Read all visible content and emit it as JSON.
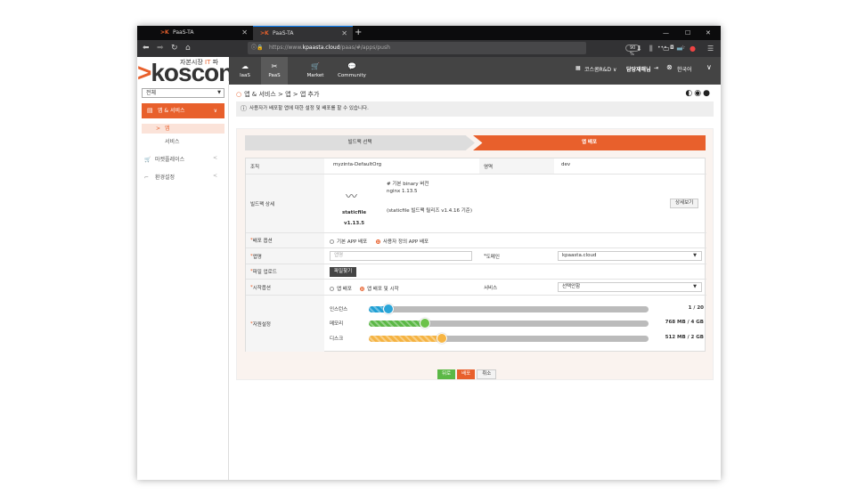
{
  "browser": {
    "tabs": [
      {
        "title": "PaaS-TA"
      },
      {
        "title": "PaaS-TA"
      }
    ],
    "new_tab": "+",
    "url_scheme": "https://www.",
    "url_host": "kpaasta.cloud",
    "url_path": "/paas/#/apps/push",
    "zoom": "90 %"
  },
  "brand": {
    "tagline_prefix": "자본시장 ",
    "tagline_it": "IT",
    "tagline_suffix": " 파",
    "logo_chevron": ">",
    "logo_text": "koscon"
  },
  "topnav": {
    "items": [
      {
        "label": "laaS",
        "icon": "cloud-icon"
      },
      {
        "label": "PaaS",
        "icon": "tools-icon"
      },
      {
        "label": "Market",
        "icon": "cart-icon"
      },
      {
        "label": "Community",
        "icon": "chat-icon"
      }
    ],
    "org": "코스콤R&D",
    "user": "담당재해님",
    "language": "한국어"
  },
  "sidebar": {
    "org_select": "전체",
    "menu_app": "앱 & 서비스",
    "sub_app": "앱",
    "sub_service": "서비스",
    "marketplace": "마켓플레이스",
    "env_settings": "환경설정"
  },
  "page": {
    "breadcrumb": "앱 & 서비스 > 앱 > 앱 추가",
    "info": "사용자가 배포할 앱에 대한 설정 및 배포를 할 수 있습니다."
  },
  "steps": {
    "step1": "빌드팩 선택",
    "step2": "앱 배포"
  },
  "form": {
    "org_label": "조직",
    "org_value": "myzinta-DefaultOrg",
    "space_label": "영역",
    "space_value": "dev",
    "buildpack_label": "빌드팩 상세",
    "buildpack_name": "staticfile",
    "buildpack_version": "v1.13.5",
    "buildpack_desc1": "# 기본 binary 버전",
    "buildpack_desc2": "nginx 1.13.5",
    "buildpack_desc3": "(staticfile 빌드팩 릴리즈 v1.4.16 기준)",
    "detail_button": "상세보기",
    "deploy_option_label": "배포 옵션",
    "deploy_opt1": "기본 APP 배포",
    "deploy_opt2": "사용자 정의 APP 배포",
    "appname_label": "앱명",
    "appname_placeholder": "앱명",
    "domain_label": "도메인",
    "domain_value": "kpaasta.cloud",
    "upload_label": "파일 업로드",
    "upload_button": "파일찾기",
    "start_option_label": "시작옵션",
    "start_opt1": "앱 배포",
    "start_opt2": "앱 배포 및 시작",
    "service_label": "서비스",
    "service_value": "선택안함",
    "resource_label": "자원설정",
    "resources": [
      {
        "label": "인스턴스",
        "value_text": "1 / 20",
        "fraction": 0.07,
        "color": "#1e9fd4",
        "knob": "#2aa5d8"
      },
      {
        "label": "메모리",
        "value_text": "768 MB / 4 GB",
        "fraction": 0.2,
        "color": "#5bb846",
        "knob": "#6cc24a"
      },
      {
        "label": "디스크",
        "value_text": "512 MB / 2 GB",
        "fraction": 0.26,
        "color": "#f5b342",
        "knob": "#f7b543"
      }
    ]
  },
  "actions": {
    "back": "뒤로",
    "deploy": "배포",
    "cancel": "취소"
  }
}
